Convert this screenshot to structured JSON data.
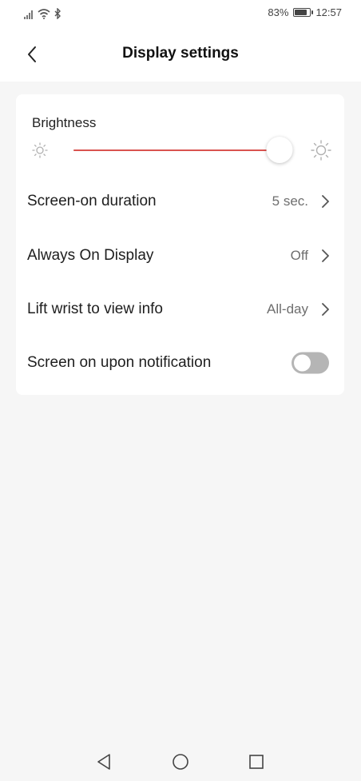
{
  "status_bar": {
    "battery_percent": "83%",
    "battery_level": 0.83,
    "time": "12:57",
    "icons": [
      "signal-icon",
      "wifi-icon",
      "bluetooth-icon",
      "battery-icon"
    ]
  },
  "header": {
    "title": "Display settings",
    "back_icon": "chevron-left-icon"
  },
  "brightness": {
    "label": "Brightness",
    "level": 0.97,
    "accent_color": "#d9534f"
  },
  "settings": {
    "screen_on_duration": {
      "label": "Screen-on duration",
      "value": "5 sec."
    },
    "always_on_display": {
      "label": "Always On Display",
      "value": "Off"
    },
    "lift_wrist": {
      "label": "Lift wrist to view info",
      "value": "All-day"
    },
    "screen_on_notification": {
      "label": "Screen on upon notification",
      "enabled": false
    }
  },
  "nav_bar": {
    "icons": [
      "nav-back-icon",
      "nav-home-icon",
      "nav-recents-icon"
    ]
  }
}
